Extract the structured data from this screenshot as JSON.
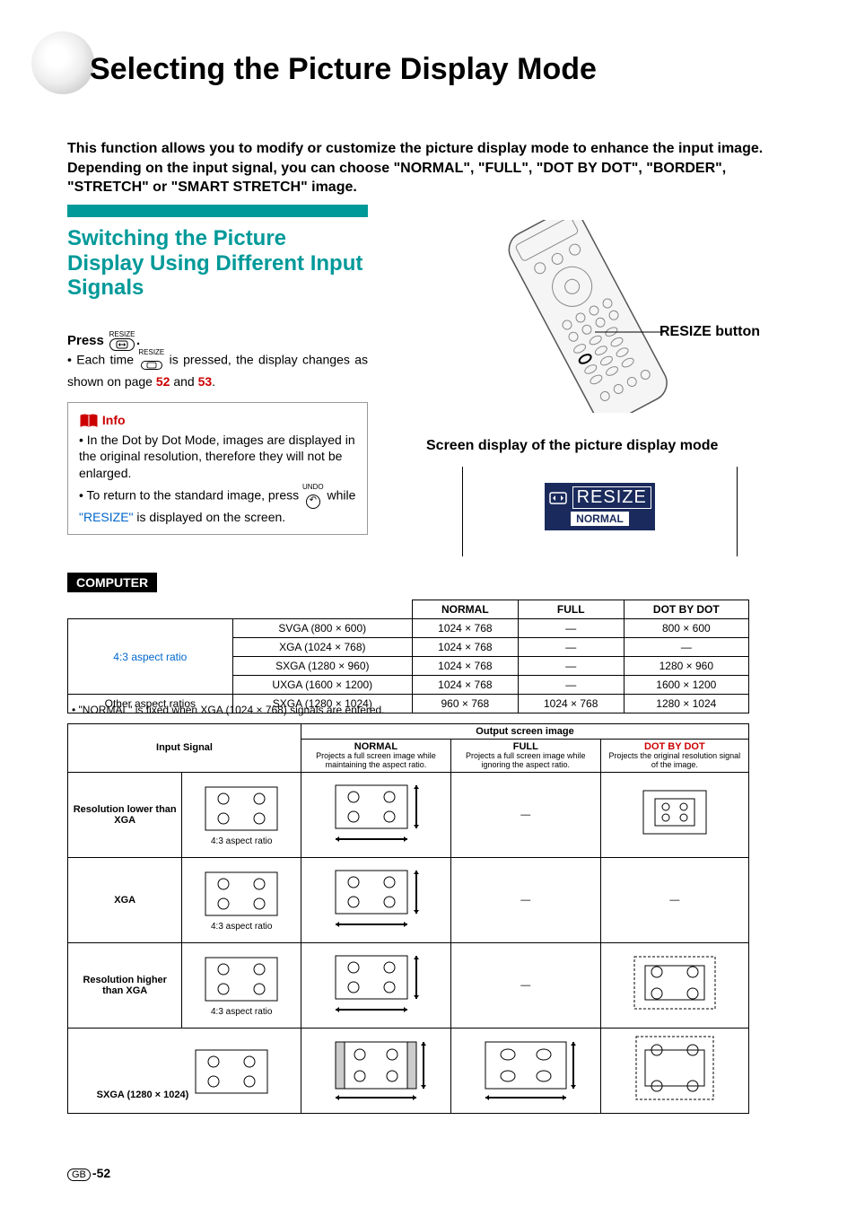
{
  "title": "Selecting the Picture Display Mode",
  "intro": "This function allows you to modify or customize the picture display mode to enhance the input image. Depending on the input signal, you can choose \"NORMAL\", \"FULL\", \"DOT BY DOT\", \"BORDER\", \"STRETCH\" or \"SMART STRETCH\" image.",
  "subhead": "Switching the Picture Display Using Different Input Signals",
  "press_label": "Press",
  "resize_pill_top": "RESIZE",
  "resize_pill_icon": "⤢",
  "each_time_1": "Each time",
  "each_time_2": "is pressed, the display changes as shown on page",
  "each_time_pg1": "52",
  "each_time_and": "and",
  "each_time_pg2": "53",
  "info_label": "Info",
  "info_bullet1": "In the Dot by Dot Mode, images are displayed in the original resolution, therefore they will not be enlarged.",
  "info_bullet2a": "To return to the standard image, press",
  "info_bullet2b": "while",
  "info_bullet2_resize": "\"RESIZE\"",
  "info_bullet2c": "is displayed on the screen.",
  "undo_label": "UNDO",
  "remote": {
    "label": "RESIZE button"
  },
  "screen_display_label": "Screen display of the picture display mode",
  "osd": {
    "resize": "RESIZE",
    "mode": "NORMAL"
  },
  "computer_tag": "COMPUTER",
  "table1": {
    "headers": [
      "NORMAL",
      "FULL",
      "DOT BY DOT"
    ],
    "rowgroup_43": "4:3 aspect ratio",
    "rows43": [
      {
        "res": "SVGA (800 × 600)",
        "normal": "1024 × 768",
        "full": "—",
        "dot": "800 × 600"
      },
      {
        "res": "XGA (1024 × 768)",
        "normal": "1024 × 768",
        "full": "—",
        "dot": "—"
      },
      {
        "res": "SXGA (1280 × 960)",
        "normal": "1024 × 768",
        "full": "—",
        "dot": "1280 × 960"
      },
      {
        "res": "UXGA (1600 × 1200)",
        "normal": "1024 × 768",
        "full": "—",
        "dot": "1600 × 1200"
      }
    ],
    "rowgroup_other": "Other aspect ratios",
    "row_other": {
      "res": "SXGA (1280 × 1024)",
      "normal": "960 × 768",
      "full": "1024 × 768",
      "dot": "1280 × 1024"
    }
  },
  "footnote1": "• \"NORMAL\" is fixed when XGA (1024 × 768) signals are entered.",
  "table2": {
    "group_header": "Output screen image",
    "input_header": "Input Signal",
    "cols": [
      {
        "name": "NORMAL",
        "desc": "Projects a full screen image while maintaining the aspect ratio.",
        "link": false
      },
      {
        "name": "FULL",
        "desc": "Projects a full screen image while ignoring the aspect ratio.",
        "link": false
      },
      {
        "name": "DOT BY DOT",
        "desc": "Projects the original resolution signal of the image.",
        "link": true
      }
    ],
    "rows": [
      {
        "label": "Resolution lower than XGA",
        "caption": "4:3 aspect ratio",
        "normal": "frame",
        "full": "dash",
        "dot": "small"
      },
      {
        "label": "XGA",
        "caption": "4:3 aspect ratio",
        "normal": "frame",
        "full": "dash",
        "dot": "dash"
      },
      {
        "label": "Resolution higher than XGA",
        "caption": "4:3 aspect ratio",
        "normal": "frame",
        "full": "dash",
        "dot": "crop-dashed"
      },
      {
        "label": "SXGA (1280 × 1024)",
        "caption": "",
        "normal": "pillar",
        "full": "frame",
        "dot": "crop-dashed-tall"
      }
    ]
  },
  "page_number": "-52",
  "gb": "GB"
}
